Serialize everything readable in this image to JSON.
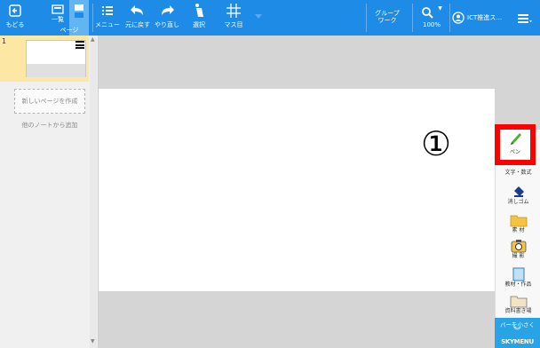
{
  "toolbar": {
    "back": "もどる",
    "list": "一覧",
    "page": "ページ",
    "menu": "メニュー",
    "undo": "元に戻す",
    "redo": "やり直し",
    "select": "選択",
    "grid": "マス目",
    "group_line1": "グループ",
    "group_line2": "ワーク",
    "zoom": "100%",
    "user": "ICT推進ス…"
  },
  "sidebar": {
    "page_number": "1",
    "new_page": "新しいページを作成",
    "add_from_other": "他のノートから追加"
  },
  "annotation": "①",
  "tools": {
    "pen": "ペン",
    "text": "文字・数式",
    "eraser": "消しゴム",
    "material": "素 材",
    "camera": "撮 影",
    "works": "教材・作品",
    "textbook": "資料書き場",
    "shrink_bar": "バーを小さく",
    "shrink_arrow": "︾",
    "brand": "SKYMENU"
  },
  "colors": {
    "toolbar": "#1e8ce6",
    "selected_tab": "#63b4f3",
    "callout_box": "#ff0000",
    "page_thumb_highlight": "#fce7a4",
    "shrink_bar": "#28a3e6"
  },
  "icons": [
    "back-icon",
    "list-icon",
    "page-icon",
    "menu-icon",
    "undo-icon",
    "redo-icon",
    "select-icon",
    "grid-icon",
    "group-icon",
    "search-icon",
    "user-icon",
    "hamburger-icon",
    "pen-icon",
    "text-icon",
    "eraser-icon",
    "folder-icon",
    "camera-icon",
    "works-icon",
    "textbook-icon"
  ]
}
